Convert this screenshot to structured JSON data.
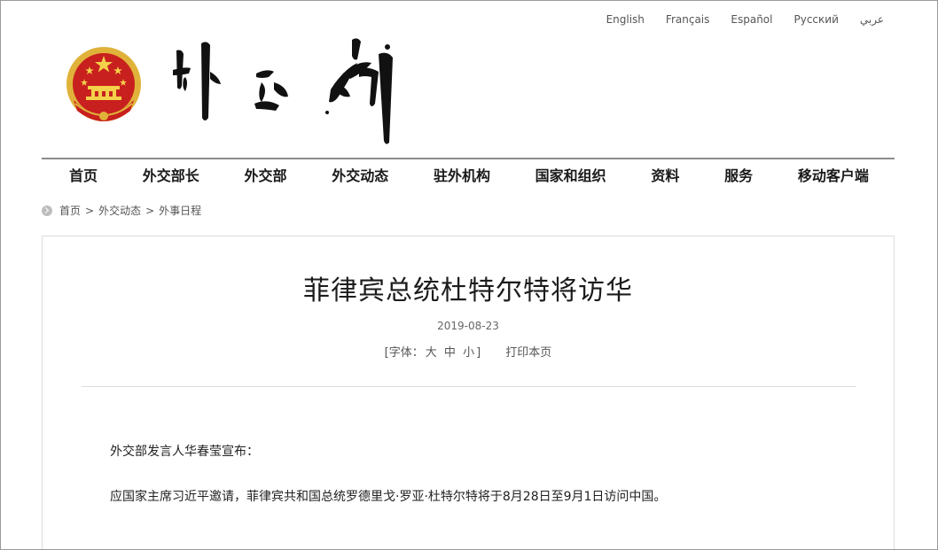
{
  "languages": [
    "English",
    "Français",
    "Español",
    "Русский",
    "عربي"
  ],
  "nav": [
    "首页",
    "外交部长",
    "外交部",
    "外交动态",
    "驻外机构",
    "国家和组织",
    "资料",
    "服务",
    "移动客户端"
  ],
  "breadcrumb": [
    "首页",
    "外交动态",
    "外事日程"
  ],
  "breadcrumb_sep": ">",
  "article": {
    "title": "菲律宾总统杜特尔特将访华",
    "date": "2019-08-23",
    "font_prefix": "[字体：",
    "font_sizes": [
      "大",
      "中",
      "小"
    ],
    "font_suffix": "]",
    "print": "打印本页",
    "paragraphs": [
      "外交部发言人华春莹宣布：",
      "应国家主席习近平邀请，菲律宾共和国总统罗德里戈·罗亚·杜特尔特将于8月28日至9月1日访问中国。"
    ]
  },
  "colors": {
    "emblem_red": "#c8201e",
    "emblem_gold": "#e0b23a",
    "nav_rule": "#8c8c8c"
  }
}
